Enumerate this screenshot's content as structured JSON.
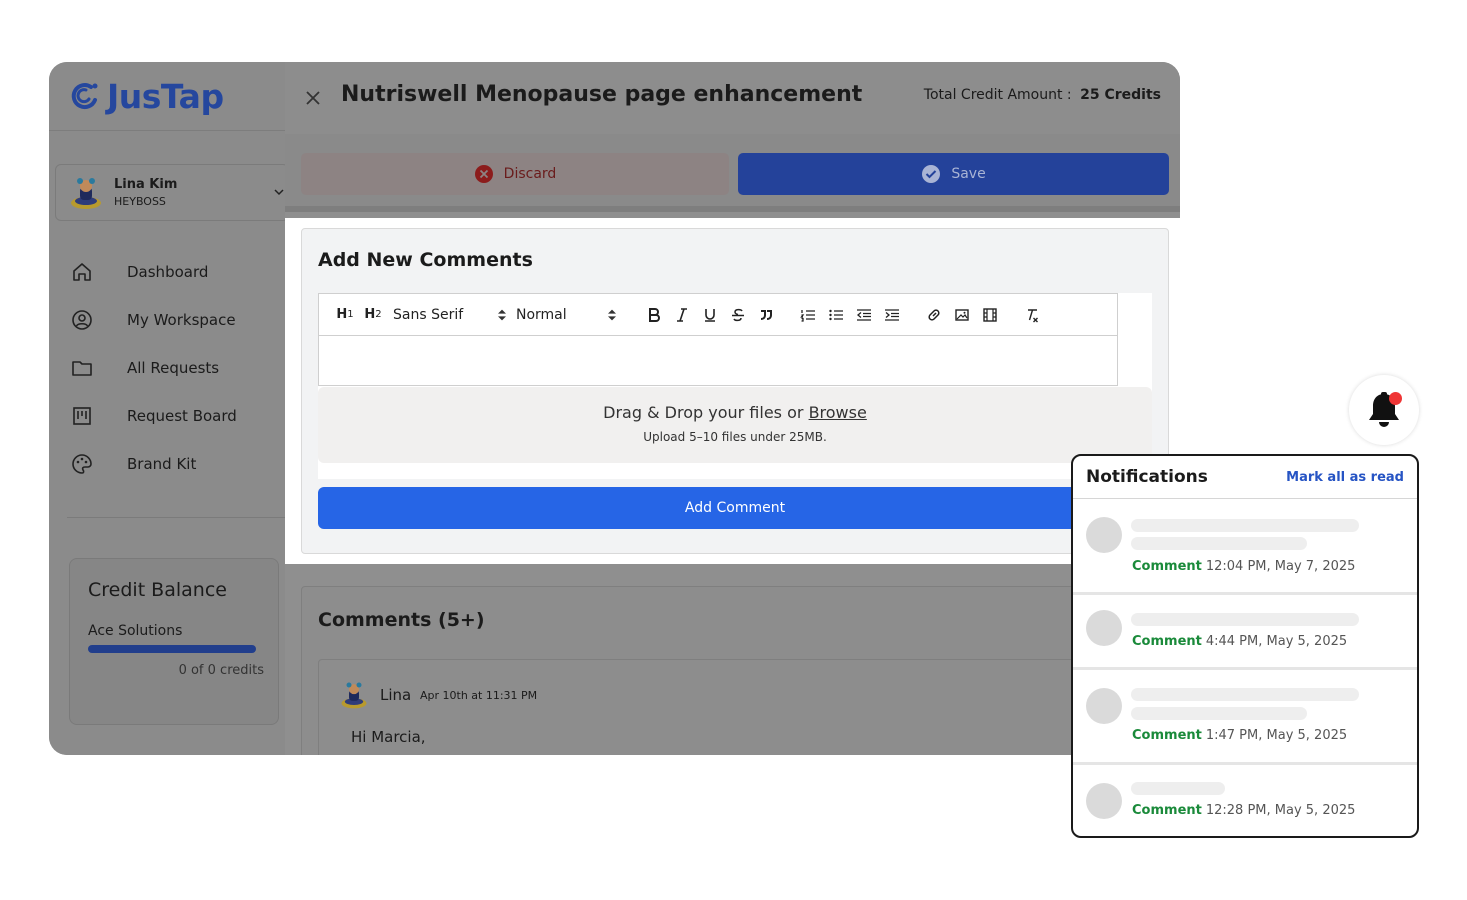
{
  "brand": {
    "name": "JusTap",
    "color": "#25479e"
  },
  "user": {
    "name": "Lina Kim",
    "role": "HEYBOSS"
  },
  "nav": [
    {
      "label": "Dashboard",
      "icon": "home-icon"
    },
    {
      "label": "My Workspace",
      "icon": "user-circle-icon"
    },
    {
      "label": "All Requests",
      "icon": "folder-icon"
    },
    {
      "label": "Request Board",
      "icon": "board-icon"
    },
    {
      "label": "Brand Kit",
      "icon": "palette-icon"
    }
  ],
  "credit": {
    "title": "Credit Balance",
    "org": "Ace Solutions",
    "count": "0 of 0 credits"
  },
  "header": {
    "title": "Nutriswell Menopause page enhancement",
    "credit_label": "Total Credit Amount :",
    "credit_value": "25 Credits"
  },
  "actions": {
    "discard": "Discard",
    "save": "Save"
  },
  "add_comments": {
    "title": "Add New Comments",
    "toolbar": {
      "h1": "H1",
      "h2": "H2",
      "font": "Sans Serif",
      "size": "Normal"
    },
    "dropzone": {
      "main": "Drag & Drop your files or",
      "browse": "Browse",
      "sub": "Upload 5–10 files under 25MB."
    },
    "button": "Add Comment"
  },
  "comments": {
    "title": "Comments (5+)",
    "items": [
      {
        "author": "Lina",
        "time": "Apr 10th at 11:31 PM",
        "body": "Hi Marcia,"
      }
    ]
  },
  "notifications": {
    "title": "Notifications",
    "mark_all": "Mark all as read",
    "items": [
      {
        "type": "Comment",
        "time": "12:04 PM, May 7, 2025"
      },
      {
        "type": "Comment",
        "time": "4:44 PM, May 5, 2025"
      },
      {
        "type": "Comment",
        "time": "1:47 PM, May 5, 2025"
      },
      {
        "type": "Comment",
        "time": "12:28 PM, May 5, 2025"
      }
    ]
  },
  "colors": {
    "primary": "#2665e6",
    "save_dimmed": "#24429a",
    "notification_dot": "#ef3535",
    "comment_tag": "#1a8a3a"
  }
}
